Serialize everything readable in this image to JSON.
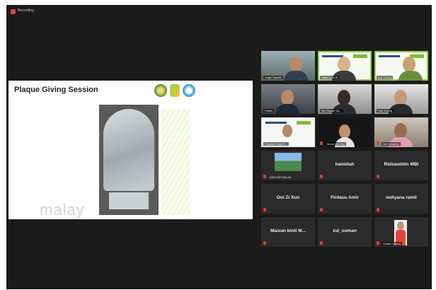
{
  "recording": {
    "label": "Recording"
  },
  "shared_screen": {
    "title": "Plaque Giving Session",
    "watermark": "malay"
  },
  "participants": [
    {
      "name": "Angie Baptist",
      "kind": "video",
      "muted": false
    },
    {
      "name": "Ngiam Hui Si",
      "kind": "video",
      "muted": false,
      "active": true
    },
    {
      "name": "Nur Cheng",
      "kind": "video",
      "muted": false
    },
    {
      "name": "Fadhli",
      "kind": "video",
      "muted": false
    },
    {
      "name": "NN Husain Sa...",
      "kind": "video",
      "muted": false
    },
    {
      "name": "Hon Cheng",
      "kind": "video",
      "muted": false
    },
    {
      "name": "Chealia Chan H...",
      "kind": "video",
      "muted": false
    },
    {
      "name": "Jenna Jemima",
      "kind": "video",
      "muted": true
    },
    {
      "name": "Ilah Zulaikha",
      "kind": "video",
      "muted": true
    },
    {
      "name": "KENYAR MALAK",
      "kind": "photo",
      "muted": true
    },
    {
      "name": "hamidah",
      "kind": "name",
      "muted": true
    },
    {
      "name": "Ridzauddin MBI",
      "kind": "name",
      "muted": true
    },
    {
      "name": "Ooi Zi Xun",
      "kind": "name",
      "muted": true
    },
    {
      "name": "Firdaus Amir",
      "kind": "name",
      "muted": true
    },
    {
      "name": "noliyana ramli",
      "kind": "name",
      "muted": true
    },
    {
      "name": "Maizan binti M...",
      "kind": "name",
      "muted": true
    },
    {
      "name": "zul_osman",
      "kind": "name",
      "muted": true
    },
    {
      "name": "Shalini Sheng",
      "kind": "avatar",
      "muted": true
    }
  ],
  "colors": {
    "active_speaker": "#8dd13c",
    "mute": "#e03b37",
    "record": "#e3403a"
  }
}
